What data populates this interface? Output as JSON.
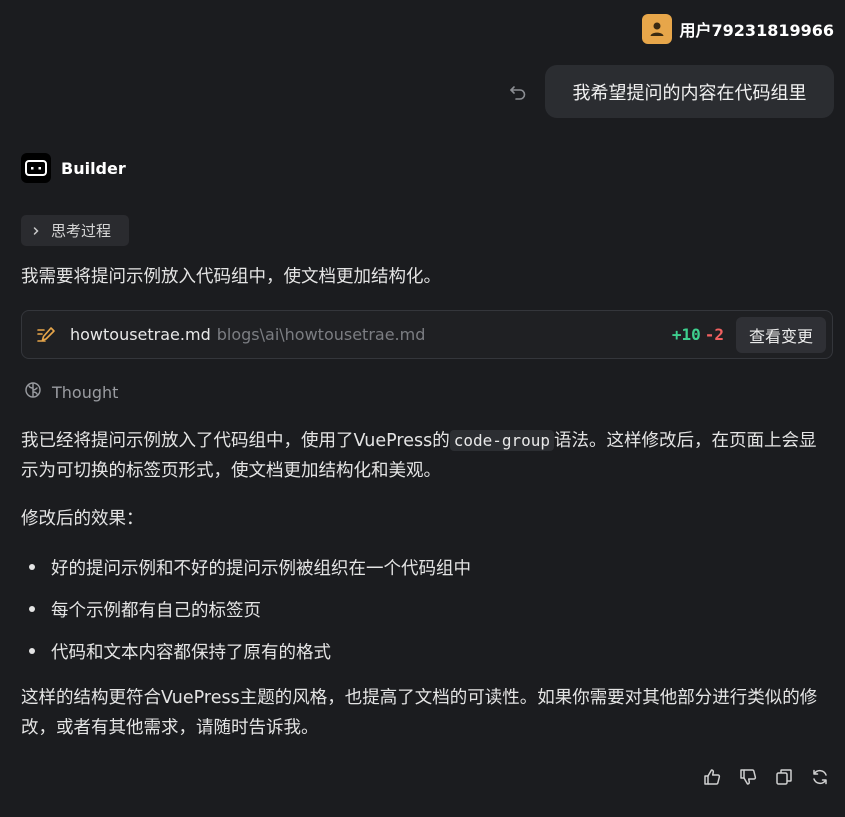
{
  "user": {
    "name": "用户79231819966",
    "avatar_icon": "user-avatar-icon",
    "avatar_color": "#e7a64a",
    "message": "我希望提问的内容在代码组里"
  },
  "assistant": {
    "name": "Builder",
    "thinking_label": "思考过程",
    "intro": "我需要将提问示例放入代码组中，使文档更加结构化。",
    "file": {
      "name": "howtousetrae.md",
      "path": "blogs\\ai\\howtousetrae.md",
      "additions": "+10",
      "deletions": "-2",
      "view_label": "查看变更"
    },
    "thought_label": "Thought",
    "para1_before": "我已经将提问示例放入了代码组中，使用了VuePress的",
    "para1_code": "code-group",
    "para1_after": "语法。这样修改后，在页面上会显示为可切换的标签页形式，使文档更加结构化和美观。",
    "effects_heading": "修改后的效果：",
    "bullets": [
      "好的提问示例和不好的提问示例被组织在一个代码组中",
      "每个示例都有自己的标签页",
      "代码和文本内容都保持了原有的格式"
    ],
    "closing": "这样的结构更符合VuePress主题的风格，也提高了文档的可读性。如果你需要对其他部分进行类似的修改，或者有其他需求，请随时告诉我。"
  },
  "colors": {
    "background": "#1b1c1f",
    "added": "#3ecf8e",
    "removed": "#f06060",
    "accent": "#e7a64a"
  }
}
